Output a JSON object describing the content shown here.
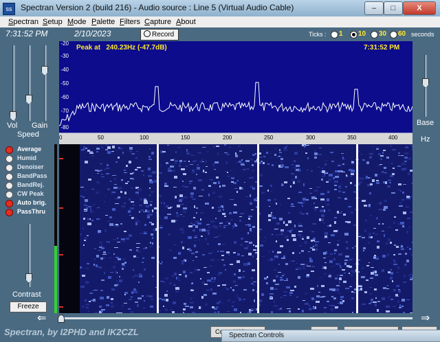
{
  "window": {
    "title": "Spectran Version 2 (build 216) - Audio source :  Line 5 (Virtual Audio Cable)",
    "min_label": "–",
    "max_label": "□",
    "close_label": "X"
  },
  "menu": [
    "Spectran",
    "Setup",
    "Mode",
    "Palette",
    "Filters",
    "Capture",
    "About"
  ],
  "menu_mnemonic": [
    "S",
    "S",
    "M",
    "P",
    "F",
    "C",
    "A"
  ],
  "toolbar": {
    "time": "7:31:52 PM",
    "date": "2/10/2023",
    "record_label": "Record",
    "ticks_label": "Ticks :",
    "tick_options": [
      "1",
      "10",
      "30",
      "60"
    ],
    "tick_selected": "10",
    "seconds_label": "seconds"
  },
  "left": {
    "vol_label": "Vol",
    "gain_label": "Gain",
    "speed_label": "Speed",
    "contrast_label": "Contrast",
    "freeze_label": "Freeze",
    "options": [
      {
        "label": "Average",
        "on": true
      },
      {
        "label": "Humid",
        "on": false
      },
      {
        "label": "Denoiser",
        "on": false
      },
      {
        "label": "BandPass",
        "on": false
      },
      {
        "label": "BandRej.",
        "on": false
      },
      {
        "label": "CW Peak",
        "on": false
      },
      {
        "label": "Auto brig.",
        "on": true
      },
      {
        "label": "PassThru",
        "on": true
      }
    ]
  },
  "right": {
    "base_label": "Base",
    "hz_label": "Hz"
  },
  "spectrum": {
    "peak_label": "Peak at",
    "peak_value": "240.23Hz (-47.7dB)",
    "clock": "7:31:52 PM",
    "db_ticks": [
      "-20",
      "-30",
      "-40",
      "-50",
      "-60",
      "-70",
      "-80"
    ],
    "freq_ticks": [
      "0",
      "50",
      "100",
      "150",
      "200",
      "250",
      "300",
      "350",
      "400"
    ]
  },
  "bottom": {
    "credit": "Spectran, by I2PHD and IK2CZL",
    "btn1": "Control Wi...",
    "panel_title": "Spectran Controls"
  },
  "colors": {
    "background": "#4a6a82",
    "spectrum_bg": "#0c0c8c",
    "label_yellow": "#ffe830",
    "option_on": "#e03020",
    "option_off": "#eeeeee"
  }
}
